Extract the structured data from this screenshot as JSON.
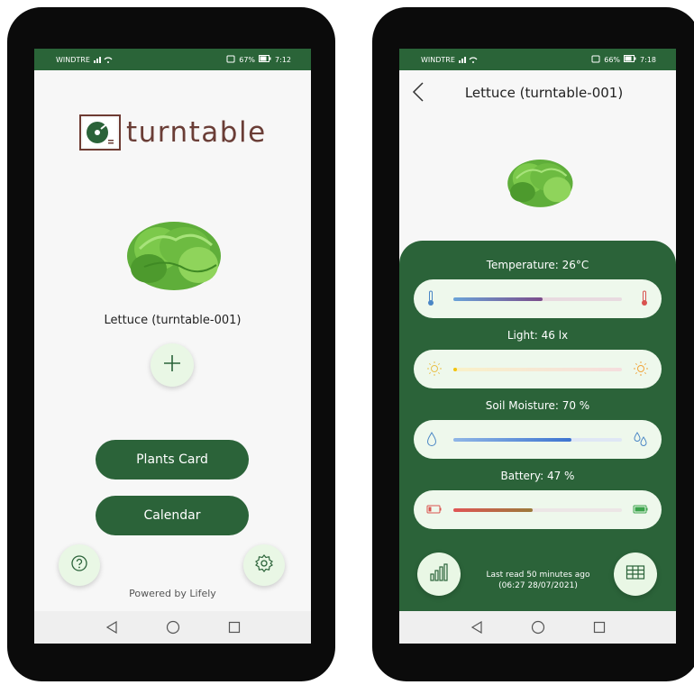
{
  "phone1": {
    "status": {
      "carrier": "WINDTRE",
      "battery": "67%",
      "time": "7:12"
    },
    "logo_text": "turntable",
    "plant_name": "Lettuce (turntable-001)",
    "add_icon": "plus-icon",
    "buttons": {
      "plants_card": "Plants Card",
      "calendar": "Calendar"
    },
    "help_icon": "help-icon",
    "settings_icon": "gear-icon",
    "footer": "Powered by Lifely"
  },
  "phone2": {
    "status": {
      "carrier": "WINDTRE",
      "battery": "66%",
      "time": "7:18"
    },
    "title": "Lettuce (turntable-001)",
    "metrics": [
      {
        "label": "Temperature: 26°C",
        "level": 0.53,
        "icon": "thermometer-icon"
      },
      {
        "label": "Light: 46 lx",
        "level": 0.02,
        "icon": "sun-icon"
      },
      {
        "label": "Soil Moisture: 70 %",
        "level": 0.7,
        "icon": "water-drop-icon"
      },
      {
        "label": "Battery: 47 %",
        "level": 0.47,
        "icon": "battery-icon"
      }
    ],
    "last_read_line1": "Last read 50 minutes ago",
    "last_read_line2": "(06:27 28/07/2021)",
    "stats_icon": "bar-chart-icon",
    "table_icon": "table-icon"
  },
  "colors": {
    "brand_green": "#2b6339",
    "status_green": "#2a6438",
    "logo_brown": "#6a3d36",
    "button_bg": "#e9f7e5"
  }
}
